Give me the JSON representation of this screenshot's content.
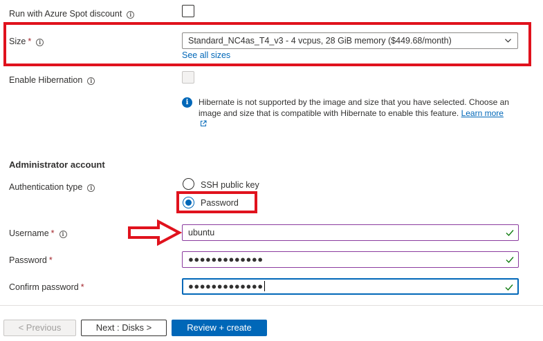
{
  "spot": {
    "label": "Run with Azure Spot discount",
    "checked": false
  },
  "size": {
    "label": "Size",
    "required_mark": "*",
    "selected": "Standard_NC4as_T4_v3 - 4 vcpus, 28 GiB memory ($449.68/month)",
    "see_all_link": "See all sizes"
  },
  "hibernation": {
    "label": "Enable Hibernation",
    "checked": false,
    "disabled": true,
    "info_text": "Hibernate is not supported by the image and size that you have selected. Choose an image and size that is compatible with Hibernate to enable this feature.",
    "learn_more": "Learn more"
  },
  "admin": {
    "section_title": "Administrator account",
    "auth_type": {
      "label": "Authentication type",
      "options": [
        {
          "label": "SSH public key",
          "selected": false
        },
        {
          "label": "Password",
          "selected": true
        }
      ]
    },
    "username": {
      "label": "Username",
      "required_mark": "*",
      "value": "ubuntu",
      "valid": true
    },
    "password": {
      "label": "Password",
      "required_mark": "*",
      "value": "●●●●●●●●●●●●●",
      "valid": true
    },
    "confirm_password": {
      "label": "Confirm password",
      "required_mark": "*",
      "value": "●●●●●●●●●●●●●",
      "valid": true
    }
  },
  "footer": {
    "previous": "< Previous",
    "next": "Next : Disks >",
    "review": "Review + create"
  },
  "colors": {
    "accent": "#0067b8",
    "annotation_red": "#e0121d",
    "valid_green": "#107c10",
    "required": "#a4262c"
  },
  "icons": [
    "info-icon",
    "chevron-down-icon",
    "external-link-icon",
    "checkmark-icon",
    "arrow-right-annotation"
  ]
}
